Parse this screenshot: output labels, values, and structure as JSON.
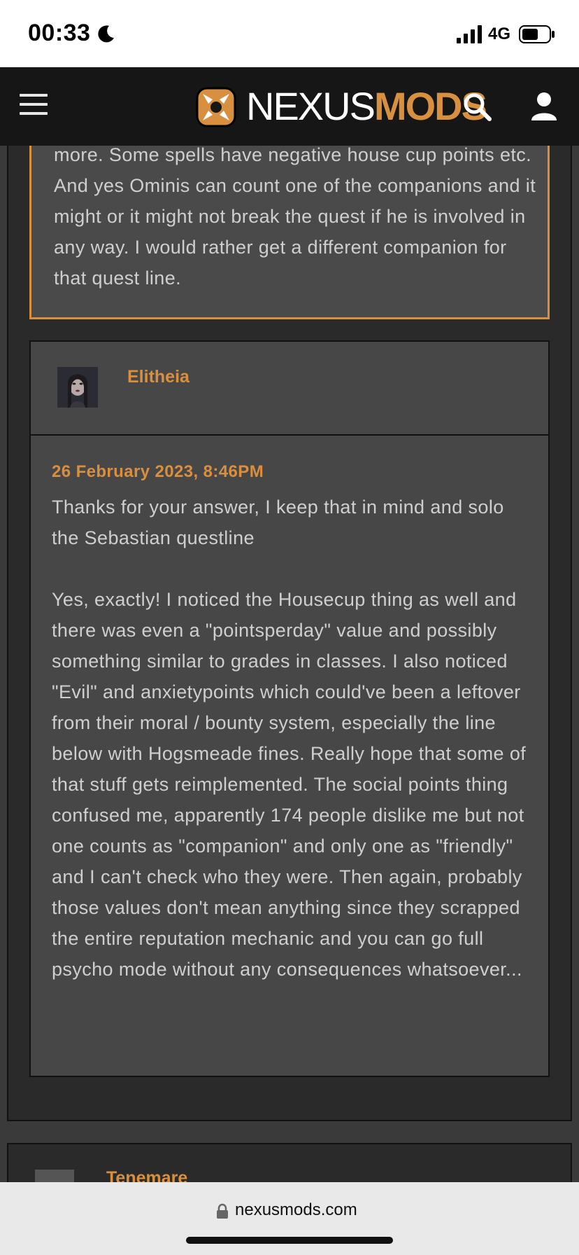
{
  "status_bar": {
    "time": "00:33",
    "network": "4G"
  },
  "header": {
    "logo_nexus": "NEXUS",
    "logo_mods": "MODS"
  },
  "quote": {
    "partial_line": "more. Some spells have negative house cup points",
    "text": "etc. And yes Ominis can count one of the companions and it might or it might not break the quest if he is involved in any way. I would rather get a different companion for that quest line."
  },
  "comment": {
    "author": "Elitheia",
    "date": "26 February 2023, 8:46PM",
    "paragraphs": [
      "Thanks for your answer, I keep that in mind and solo the Sebastian questline",
      "Yes, exactly! I noticed the Housecup thing as well and there was even a \"pointsperday\" value and possibly something similar to grades in classes. I also noticed \"Evil\" and anxietypoints which could've been a leftover from their moral / bounty system, especially the line below with Hogsmeade fines. Really hope that some of that stuff gets reimplemented. The social points thing confused me, apparently 174 people dislike me but not one counts as \"companion\" and only one as \"friendly\" and I can't check who they were. Then again, probably those values don't mean anything since they scrapped the entire reputation mechanic and you can go full psycho mode without any consequences whatsoever..."
    ]
  },
  "next_comment": {
    "author": "Tenemare"
  },
  "browser": {
    "url": "nexusmods.com"
  },
  "colors": {
    "accent": "#d98f40",
    "header_bg": "#161616",
    "panel_bg": "#474747"
  }
}
